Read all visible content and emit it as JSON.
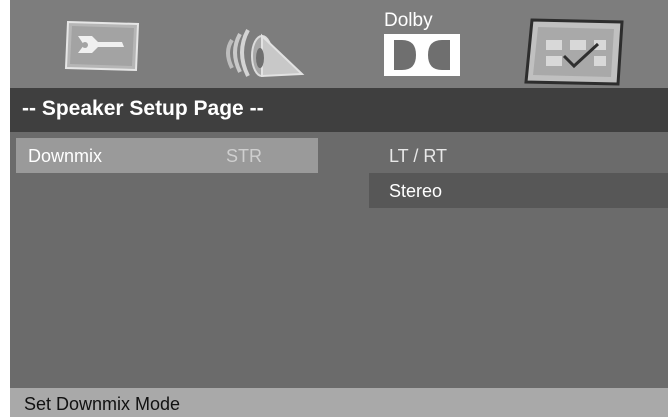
{
  "tabs": {
    "dolby_label": "Dolby"
  },
  "page_title": "-- Speaker Setup Page --",
  "menu": {
    "items": [
      {
        "label": "Downmix",
        "value": "STR"
      }
    ]
  },
  "options": [
    {
      "label": "LT / RT"
    },
    {
      "label": "Stereo"
    }
  ],
  "status_text": "Set Downmix Mode",
  "colors": {
    "background": "#6b6b6b",
    "top_bar": "#7d7d7d",
    "header": "#3f3f3f",
    "selected_row": "#9a9a9a",
    "highlighted_option": "#575757",
    "status_bar": "#a9a9a9"
  },
  "icons": [
    "general-setup-icon",
    "speaker-icon",
    "dolby-icon",
    "preference-check-icon"
  ]
}
